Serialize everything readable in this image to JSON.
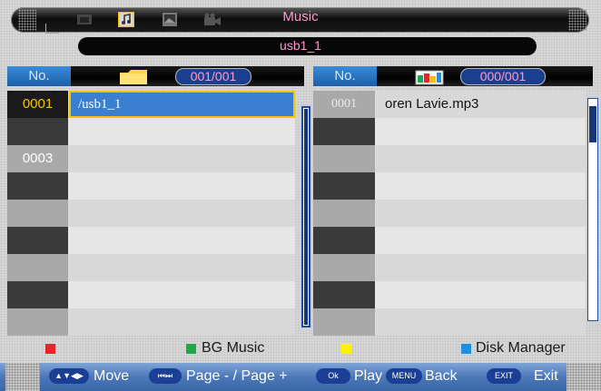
{
  "header": {
    "title": "Music",
    "path": "usb1_1"
  },
  "tabs": [
    {
      "name": "photo-tab-icon",
      "active": false
    },
    {
      "name": "music-tab-icon",
      "active": true
    },
    {
      "name": "movie-tab-icon",
      "active": false
    },
    {
      "name": "text-tab-icon",
      "active": false
    }
  ],
  "left_panel": {
    "no_label": "No.",
    "count": "001/001",
    "rows": [
      {
        "no": "0001",
        "text": "/usb1_1",
        "selected": true
      },
      {
        "no": "",
        "text": ""
      },
      {
        "no": "0003",
        "text": ""
      },
      {
        "no": "",
        "text": ""
      },
      {
        "no": "",
        "text": ""
      },
      {
        "no": "",
        "text": ""
      },
      {
        "no": "",
        "text": ""
      },
      {
        "no": "",
        "text": ""
      },
      {
        "no": "",
        "text": ""
      }
    ]
  },
  "right_panel": {
    "no_label": "No.",
    "count": "000/001",
    "rows": [
      {
        "no": "0001",
        "text": "oren Lavie.mp3"
      },
      {
        "no": "",
        "text": ""
      },
      {
        "no": "",
        "text": ""
      },
      {
        "no": "",
        "text": ""
      },
      {
        "no": "",
        "text": ""
      },
      {
        "no": "",
        "text": ""
      },
      {
        "no": "",
        "text": ""
      },
      {
        "no": "",
        "text": ""
      },
      {
        "no": "",
        "text": ""
      }
    ]
  },
  "legend": {
    "red_label": "",
    "green_label": "BG Music",
    "yellow_label": "",
    "blue_label": "Disk Manager",
    "colors": {
      "red": "#e8232b",
      "green": "#1fa84a",
      "yellow": "#fff200",
      "blue": "#1f8fe0"
    }
  },
  "footer": {
    "move_key": "▲▼◀▶",
    "move_label": "Move",
    "page_key": "⏮⏭",
    "page_label": "Page - / Page +",
    "ok_key": "Ok",
    "play_label": "Play",
    "menu_key": "MENU",
    "back_label": "Back",
    "exit_key": "EXIT",
    "exit_label": "Exit"
  }
}
